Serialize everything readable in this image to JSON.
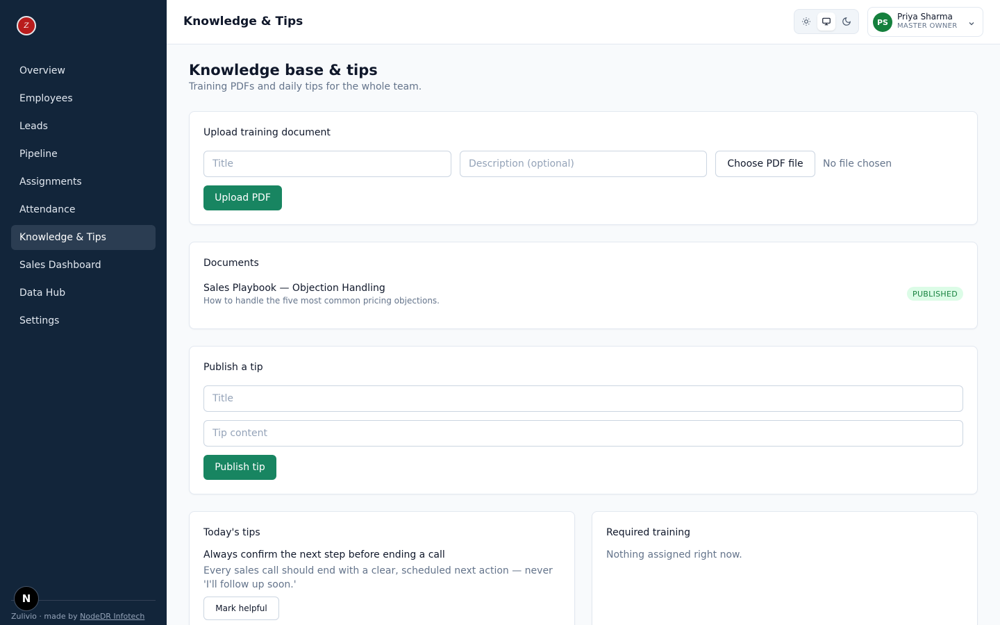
{
  "sidebar": {
    "logo_text": "Z",
    "items": [
      {
        "label": "Overview"
      },
      {
        "label": "Employees"
      },
      {
        "label": "Leads"
      },
      {
        "label": "Pipeline"
      },
      {
        "label": "Assignments"
      },
      {
        "label": "Attendance"
      },
      {
        "label": "Knowledge & Tips",
        "active": true
      },
      {
        "label": "Sales Dashboard"
      },
      {
        "label": "Data Hub"
      },
      {
        "label": "Settings"
      }
    ],
    "footer_prefix": "Zulivio · made by ",
    "footer_link": "NodeDR Infotech",
    "n_badge": "N"
  },
  "header": {
    "title": "Knowledge & Tips",
    "theme_options": [
      "sun-icon",
      "monitor-icon",
      "moon-icon"
    ],
    "theme_selected": "monitor-icon",
    "user": {
      "initials": "PS",
      "name": "Priya Sharma",
      "role": "MASTER OWNER"
    }
  },
  "page": {
    "title": "Knowledge base & tips",
    "subtitle": "Training PDFs and daily tips for the whole team."
  },
  "upload": {
    "title": "Upload training document",
    "title_placeholder": "Title",
    "description_placeholder": "Description (optional)",
    "choose_file_label": "Choose PDF file",
    "file_status": "No file chosen",
    "upload_button": "Upload PDF"
  },
  "documents": {
    "title": "Documents",
    "items": [
      {
        "name": "Sales Playbook — Objection Handling",
        "description": "How to handle the five most common pricing objections.",
        "status": "PUBLISHED"
      }
    ]
  },
  "publish_tip": {
    "title": "Publish a tip",
    "title_placeholder": "Title",
    "content_placeholder": "Tip content",
    "publish_button": "Publish tip"
  },
  "todays_tips": {
    "title": "Today's tips",
    "items": [
      {
        "headline": "Always confirm the next step before ending a call",
        "body": "Every sales call should end with a clear, scheduled next action — never 'I'll follow up soon.'",
        "action": "Mark helpful"
      }
    ]
  },
  "required_training": {
    "title": "Required training",
    "empty": "Nothing assigned right now."
  },
  "colors": {
    "sidebar_bg": "#12253a",
    "primary": "#188561",
    "badge_bg": "#dcfce7",
    "badge_text": "#15803d"
  }
}
